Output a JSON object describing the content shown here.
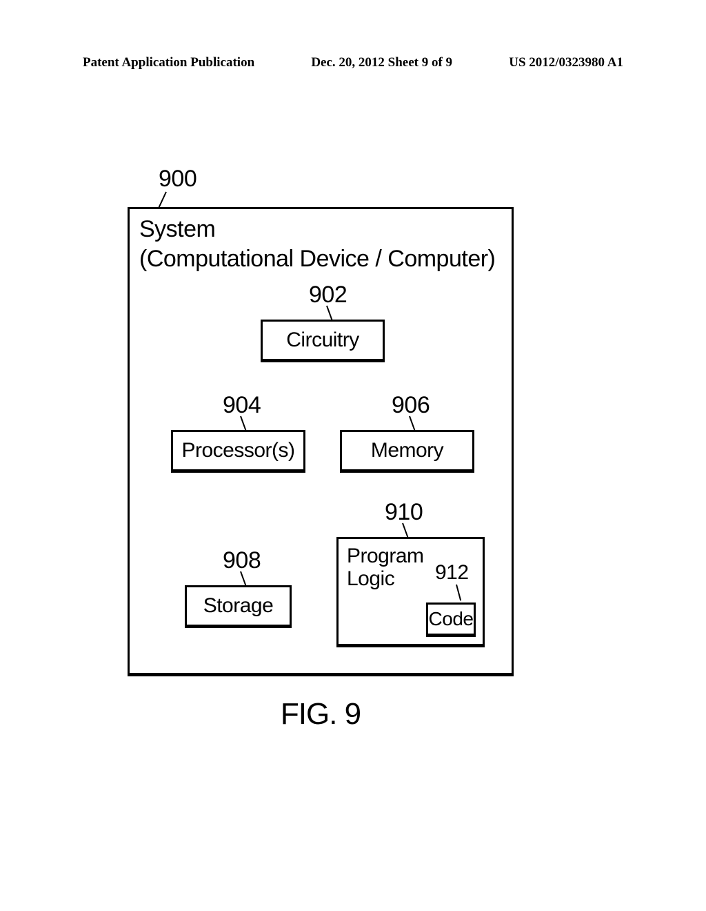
{
  "header": {
    "left": "Patent Application Publication",
    "center": "Dec. 20, 2012  Sheet 9 of 9",
    "right": "US 2012/0323980 A1"
  },
  "refs": {
    "system": "900",
    "circuitry": "902",
    "processors": "904",
    "memory": "906",
    "storage": "908",
    "program_logic": "910",
    "code": "912"
  },
  "labels": {
    "system_line1": "System",
    "system_line2": "(Computational Device / Computer)",
    "circuitry": "Circuitry",
    "processors": "Processor(s)",
    "memory": "Memory",
    "program_logic_line1": "Program",
    "program_logic_line2": "Logic",
    "storage": "Storage",
    "code": "Code"
  },
  "caption": "FIG. 9"
}
